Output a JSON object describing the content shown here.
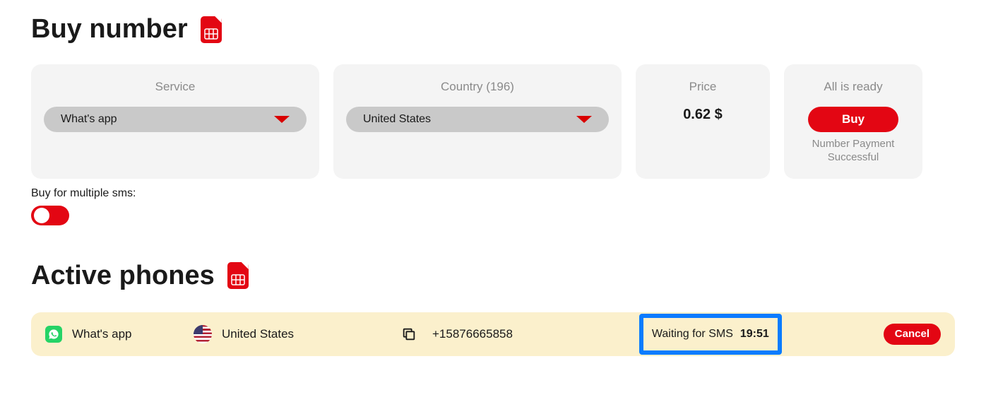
{
  "buy": {
    "title": "Buy number",
    "service_label": "Service",
    "service_value": "What's app",
    "country_label": "Country (196)",
    "country_value": "United States",
    "price_label": "Price",
    "price_value": "0.62 $",
    "ready_label": "All is ready",
    "buy_button": "Buy",
    "status": "Number Payment Successful",
    "multi_sms_label": "Buy for multiple sms:"
  },
  "active": {
    "title": "Active phones",
    "row": {
      "service": "What's app",
      "country": "United States",
      "phone": "+15876665858",
      "status": "Waiting for SMS",
      "time": "19:51",
      "cancel": "Cancel"
    }
  }
}
